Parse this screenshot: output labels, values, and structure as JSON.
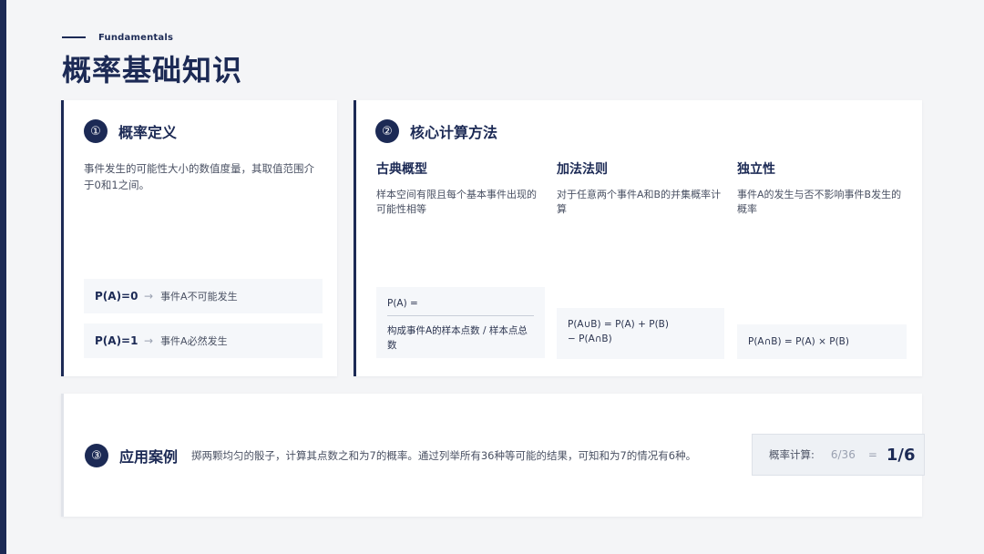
{
  "header": {
    "eyebrow": "Fundamentals",
    "title": "概率基础知识"
  },
  "definition": {
    "number": "①",
    "title": "概率定义",
    "description": "事件发生的可能性大小的数值度量，其取值范围介于0和1之间。",
    "rows": [
      {
        "formula": "P(A)=0",
        "arrow": "→",
        "desc": "事件A不可能发生"
      },
      {
        "formula": "P(A)=1",
        "arrow": "→",
        "desc": "事件A必然发生"
      }
    ]
  },
  "methods": {
    "number": "②",
    "title": "核心计算方法",
    "items": [
      {
        "title": "古典概型",
        "text": "样本空间有限且每个基本事件出现的可能性相等",
        "formula_top": "P(A) =",
        "formula_bottom": "构成事件A的样本点数 / 样本点总数"
      },
      {
        "title": "加法法则",
        "text": "对于任意两个事件A和B的并集概率计算",
        "formula_line1": "P(A∪B) = P(A) + P(B)",
        "formula_line2": "− P(A∩B)"
      },
      {
        "title": "独立性",
        "text": "事件A的发生与否不影响事件B发生的概率",
        "formula": "P(A∩B) = P(A) × P(B)"
      }
    ]
  },
  "application": {
    "number": "③",
    "title": "应用案例",
    "text": "掷两颗均匀的骰子，计算其点数之和为7的概率。通过列举所有36种等可能的结果，可知和为7的情况有6种。",
    "result_label": "概率计算:",
    "result_fraction": "6/36",
    "result_eq": "=",
    "result_value": "1/6"
  }
}
